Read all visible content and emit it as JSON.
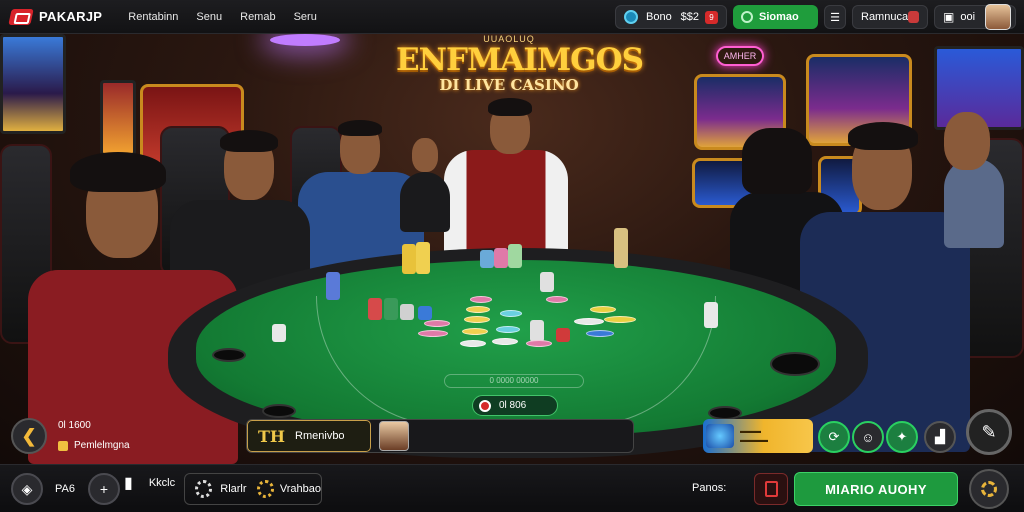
{
  "brand": {
    "name": "PAKARJP"
  },
  "nav": {
    "items": [
      "Rentabinn",
      "Senu",
      "Remab",
      "Seru"
    ]
  },
  "topbar": {
    "balance_label": "Bono",
    "balance_value": "$$2",
    "balance_badge": "9",
    "deposit_label": "Siomao",
    "promo_label": "Ramnuca",
    "user_label": "ooi"
  },
  "scene": {
    "sign_top": "UUAOLUQ",
    "sign_main": "ENFMAIMGOS",
    "sign_sub": "DI LIVE CASINO",
    "small_sign": "AMHER",
    "felt_label": "0 0000 00000"
  },
  "bet": {
    "amount": "0l 806"
  },
  "left_info": {
    "line1": "0l 1600",
    "line2": "Pemlelmgna"
  },
  "dealer": {
    "icon_text": "TH",
    "name": "Rmenivbo"
  },
  "bottom": {
    "item1_label": "PA6",
    "item2_label": "Kkclc",
    "group_label1": "Rlarlr",
    "group_label2": "Vrahbao",
    "right_label": "Panos:",
    "cta_label": "MIARIO AUOHY"
  },
  "icons": {
    "back": "chevron-left-icon",
    "chat": "chat-bubble-icon",
    "settings": "gear-icon",
    "add": "plus-icon"
  },
  "colors": {
    "accent_green": "#1e9a3e",
    "accent_gold": "#f0c94a",
    "alert_red": "#d62a2a",
    "felt": "#137a33"
  }
}
